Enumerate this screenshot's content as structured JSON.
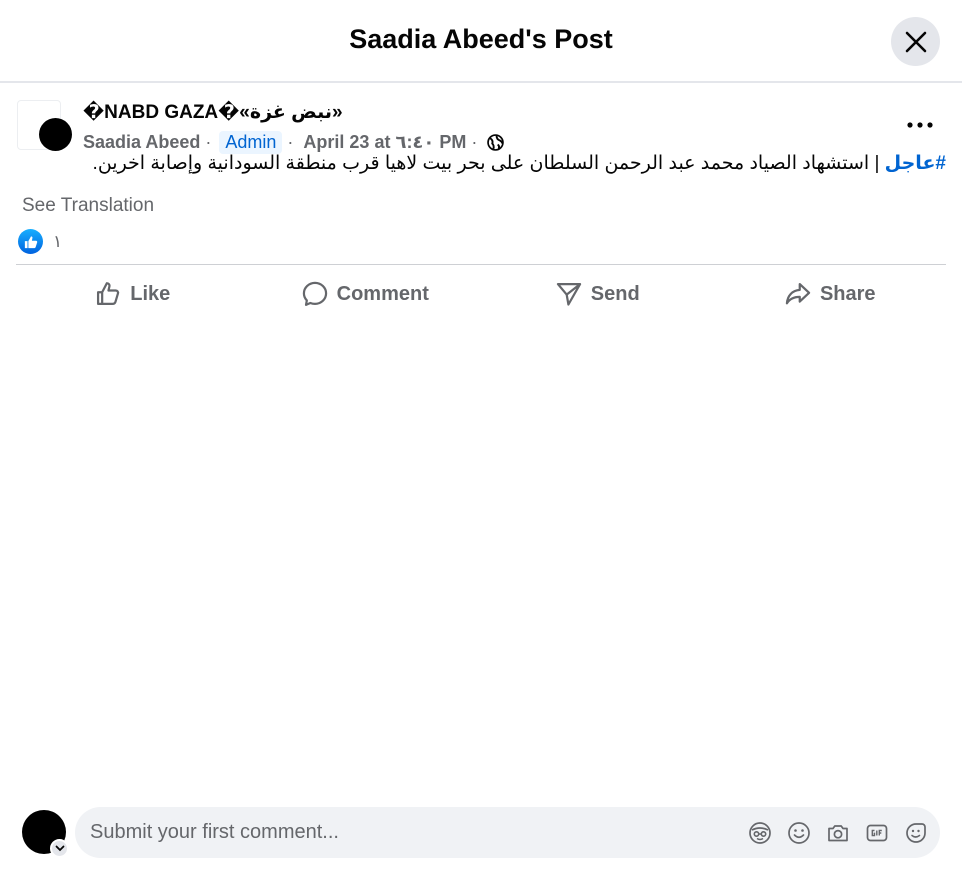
{
  "header": {
    "title": "Saadia Abeed's Post",
    "close_icon": "close-icon"
  },
  "post": {
    "group_name": "�NABD GAZA�«نبض غزة»",
    "author": "Saadia Abeed",
    "separator": "·",
    "role_badge": "Admin",
    "date": "April 23 at ٦:٤٠ PM",
    "date_separator": "·",
    "audience_icon": "globe-icon",
    "more_icon": "more-options-icon",
    "hashtag": "#عاجل",
    "text": " | استشهاد الصياد محمد عبد الرحمن السلطان على بحر بيت لاهيا قرب منطقة السودانية وإصابة اخرين.",
    "see_translation": "See Translation",
    "reaction_icon": "like-reaction-icon",
    "reaction_count": "١"
  },
  "actions": {
    "like": "Like",
    "comment": "Comment",
    "send": "Send",
    "share": "Share"
  },
  "composer": {
    "placeholder": "Submit your first comment...",
    "icons": [
      "avatar-sticker-icon",
      "emoji-icon",
      "camera-icon",
      "gif-icon",
      "sticker-icon"
    ]
  },
  "colors": {
    "accent": "#0064d1",
    "muted_text": "#65676b",
    "like_blue": "#0866ff",
    "surface": "#f0f2f5"
  }
}
